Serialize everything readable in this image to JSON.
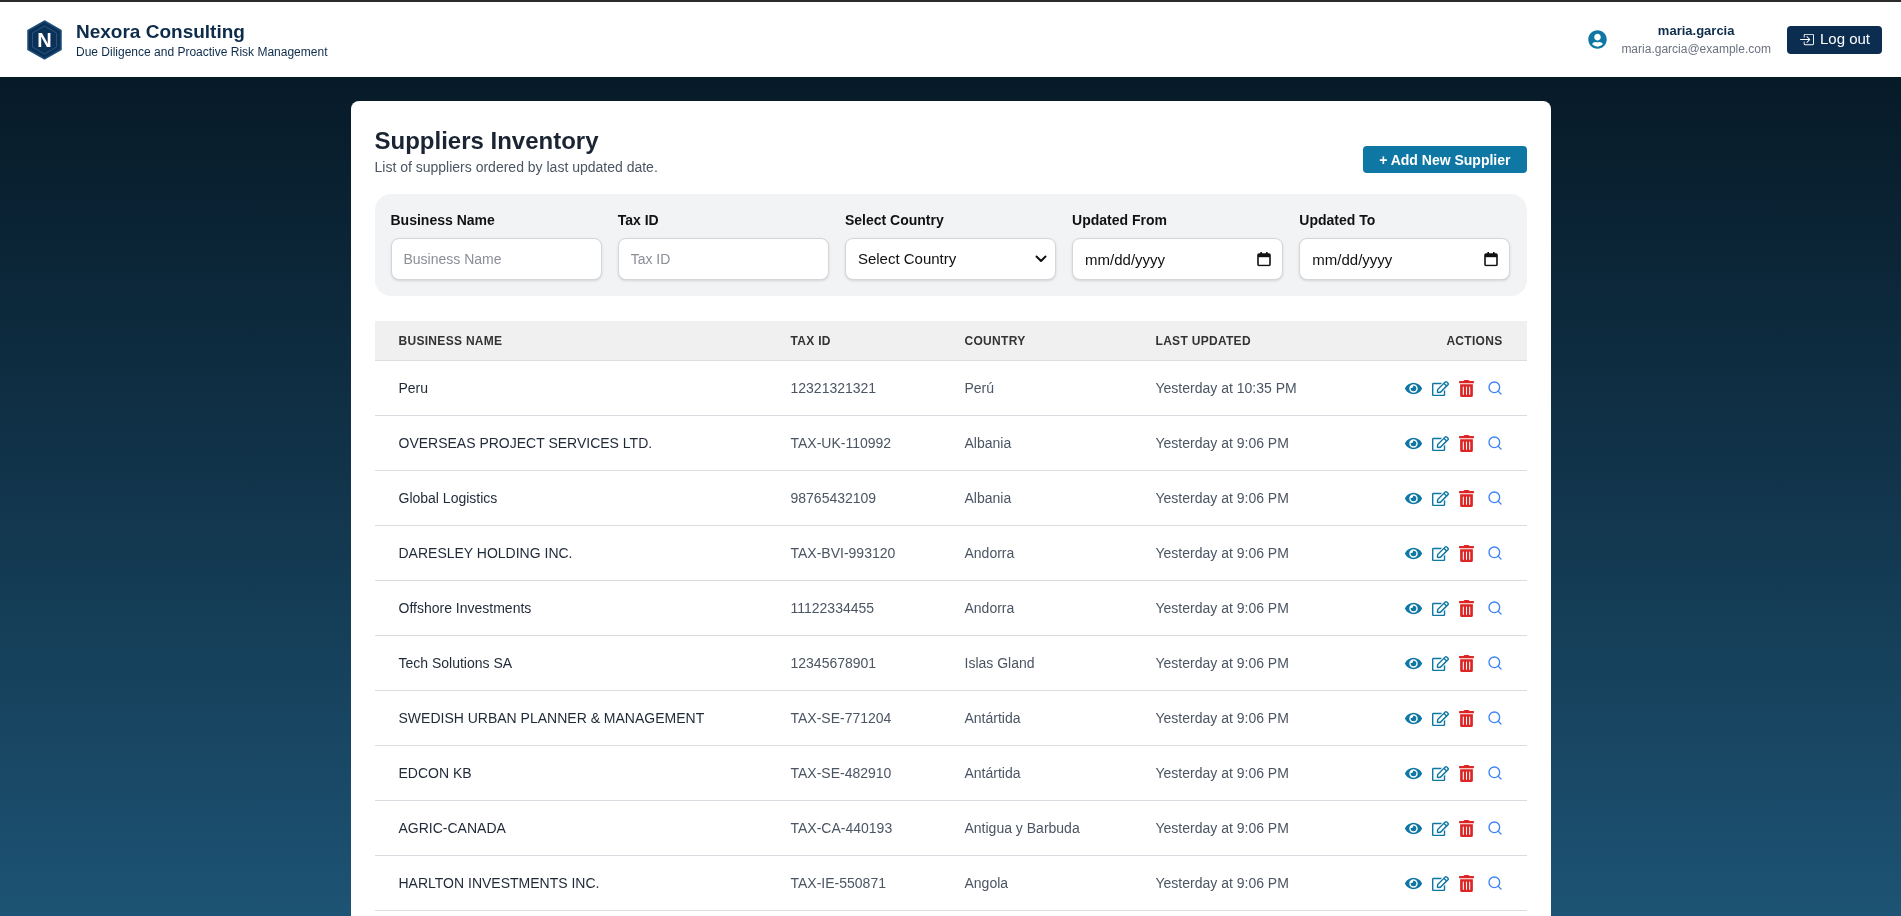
{
  "header": {
    "logo_letter": "N",
    "brand": "Nexora Consulting",
    "tagline": "Due Diligence and Proactive Risk Management",
    "user": {
      "username": "maria.garcia",
      "email": "maria.garcia@example.com"
    },
    "logout_button": "Log out"
  },
  "page": {
    "title": "Suppliers Inventory",
    "subtitle": "List of suppliers ordered by last updated date.",
    "add_button": "+ Add New Supplier"
  },
  "filters": [
    {
      "kind": "text",
      "label": "Business Name",
      "placeholder": "Business Name"
    },
    {
      "kind": "text",
      "label": "Tax ID",
      "placeholder": "Tax ID"
    },
    {
      "kind": "select",
      "label": "Select Country",
      "value": "Select Country"
    },
    {
      "kind": "date",
      "label": "Updated From",
      "placeholder": "mm/dd/yyyy"
    },
    {
      "kind": "date",
      "label": "Updated To",
      "placeholder": "mm/dd/yyyy"
    }
  ],
  "table": {
    "columns": [
      "BUSINESS NAME",
      "TAX ID",
      "COUNTRY",
      "LAST UPDATED",
      "ACTIONS"
    ],
    "rows": [
      {
        "business_name": "Peru",
        "tax_id": "12321321321",
        "country": "Perú",
        "last_updated": "Yesterday at 10:35 PM"
      },
      {
        "business_name": "OVERSEAS PROJECT SERVICES LTD.",
        "tax_id": "TAX-UK-110992",
        "country": "Albania",
        "last_updated": "Yesterday at 9:06 PM"
      },
      {
        "business_name": "Global Logistics",
        "tax_id": "98765432109",
        "country": "Albania",
        "last_updated": "Yesterday at 9:06 PM"
      },
      {
        "business_name": "DARESLEY HOLDING INC.",
        "tax_id": "TAX-BVI-993120",
        "country": "Andorra",
        "last_updated": "Yesterday at 9:06 PM"
      },
      {
        "business_name": "Offshore Investments",
        "tax_id": "11122334455",
        "country": "Andorra",
        "last_updated": "Yesterday at 9:06 PM"
      },
      {
        "business_name": "Tech Solutions SA",
        "tax_id": "12345678901",
        "country": "Islas Gland",
        "last_updated": "Yesterday at 9:06 PM"
      },
      {
        "business_name": "SWEDISH URBAN PLANNER & MANAGEMENT",
        "tax_id": "TAX-SE-771204",
        "country": "Antártida",
        "last_updated": "Yesterday at 9:06 PM"
      },
      {
        "business_name": "EDCON KB",
        "tax_id": "TAX-SE-482910",
        "country": "Antártida",
        "last_updated": "Yesterday at 9:06 PM"
      },
      {
        "business_name": "AGRIC-CANADA",
        "tax_id": "TAX-CA-440193",
        "country": "Antigua y Barbuda",
        "last_updated": "Yesterday at 9:06 PM"
      },
      {
        "business_name": "HARLTON INVESTMENTS INC.",
        "tax_id": "TAX-IE-550871",
        "country": "Angola",
        "last_updated": "Yesterday at 9:06 PM"
      }
    ]
  }
}
